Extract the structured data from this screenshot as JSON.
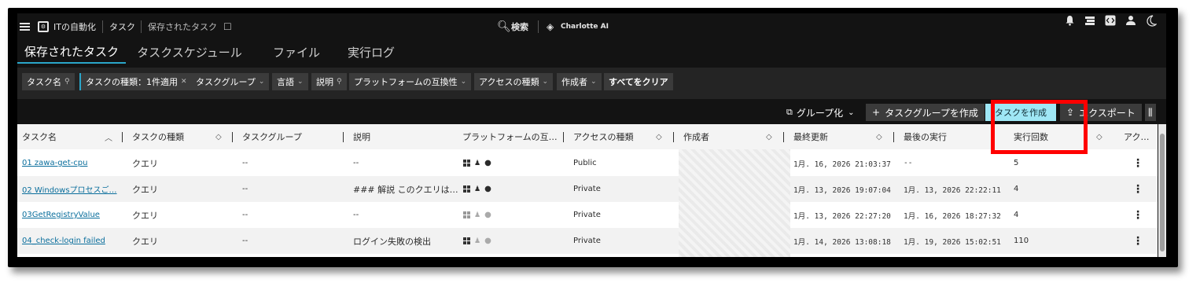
{
  "topbar": {
    "app_name": "ITの自動化",
    "breadcrumb_1": "タスク",
    "breadcrumb_2": "保存されたタスク",
    "search_label": "検索",
    "ai_label": "Charlotte AI"
  },
  "tabs": [
    {
      "label": "保存されたタスク",
      "active": true
    },
    {
      "label": "タスクスケジュール"
    },
    {
      "label": "ファイル"
    },
    {
      "label": "実行ログ"
    }
  ],
  "filters": [
    "タスク名",
    "タスクの種類：1件適用",
    "タスクグループ",
    "言語",
    "説明",
    "プラットフォームの互換性",
    "アクセスの種類",
    "作成者",
    "すべてをクリア"
  ],
  "actions": {
    "group": "グループ化",
    "create_group": "タスクグループを作成",
    "create_task": "タスクを作成",
    "export": "エクスポート"
  },
  "columns": [
    "タスク名",
    "タスクの種類",
    "タスクグループ",
    "説明",
    "プラットフォームの互…",
    "アクセスの種類",
    "作成者",
    "最終更新",
    "最後の実行",
    "実行回数",
    "アク…"
  ],
  "rows": [
    {
      "name": "01 zawa-get-cpu",
      "type": "クエリ",
      "group": "--",
      "desc": "--",
      "access": "Public",
      "updated": "1月. 16, 2026 21:03:37",
      "last_run": "--",
      "runs": "5"
    },
    {
      "name": "02 Windowsプロセスご…",
      "type": "クエリ",
      "group": "--",
      "desc": "### 解説 このクエリは…",
      "access": "Private",
      "updated": "1月. 13, 2026 19:07:04",
      "last_run": "1月. 13, 2026 22:22:11",
      "runs": "4"
    },
    {
      "name": "03GetRegistryValue",
      "type": "クエリ",
      "group": "--",
      "desc": "--",
      "access": "Private",
      "updated": "1月. 13, 2026 22:27:20",
      "last_run": "1月. 16, 2026 18:27:32",
      "runs": "4"
    },
    {
      "name": "04_check-login failed",
      "type": "クエリ",
      "group": "--",
      "desc": "ログイン失敗の検出",
      "access": "Private",
      "updated": "1月. 14, 2026 13:08:18",
      "last_run": "1月. 19, 2026 15:02:51",
      "runs": "110"
    }
  ],
  "colors": {
    "accent": "#2aa6c9",
    "create_button": "#9fe7f5",
    "highlight": "#ff0000",
    "link": "#0a6e9c"
  }
}
